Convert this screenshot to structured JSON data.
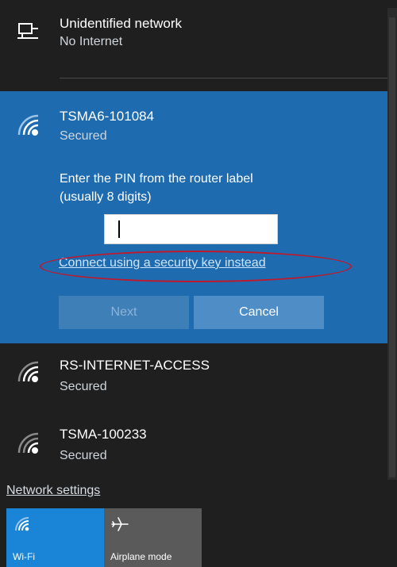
{
  "networks": {
    "current": {
      "name": "Unidentified network",
      "status": "No Internet",
      "icon": "monitor-network-icon"
    },
    "selected": {
      "name": "TSMA6-101084",
      "status": "Secured",
      "icon": "wifi-secured-icon",
      "prompt_line1": "Enter the PIN from the router label",
      "prompt_line2": "(usually 8 digits)",
      "pin_value": "",
      "alt_link": "Connect using a security key instead",
      "next_label": "Next",
      "cancel_label": "Cancel"
    },
    "list": [
      {
        "name": "RS-INTERNET-ACCESS",
        "status": "Secured",
        "icon": "wifi-secured-icon"
      },
      {
        "name": "TSMA-100233",
        "status": "Secured",
        "icon": "wifi-secured-icon"
      }
    ]
  },
  "footer": {
    "settings_link": "Network settings",
    "tiles": [
      {
        "label": "Wi-Fi",
        "icon": "wifi-icon",
        "active": true
      },
      {
        "label": "Airplane mode",
        "icon": "airplane-icon",
        "active": false
      }
    ]
  },
  "colors": {
    "panel_bg": "#1f1f1f",
    "selected_bg": "#1e6bb0",
    "accent_tile": "#1a84d6",
    "highlight_ellipse": "#c0192c"
  }
}
